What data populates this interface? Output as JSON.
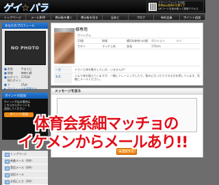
{
  "header": {
    "logo_main": "ゲイ",
    "logo_dot": "☆",
    "logo_end": "パラ",
    "promo_lines": [
      "スマートフォンにも対応",
      "携帯版は登録が必要です",
      "QRコードを読み取って簡単アクセス"
    ]
  },
  "nav": [
    "トップページ",
    "メールBOX",
    "掲示板を書く",
    "掲示板を見る",
    "足あと",
    "プロフ",
    "有料会員",
    "ポイント追加"
  ],
  "sidebar": {
    "profile_title": "あなたのプロフィール",
    "nophoto_text": "NO PHOTO",
    "profile_lines": [
      {
        "label": "名前",
        "value": "やまとに"
      },
      {
        "label": "地域",
        "value": "神奈川県"
      },
      {
        "label": "ログイン",
        "value": "27028"
      },
      {
        "label": "残りポイント",
        "value": "21pt"
      }
    ],
    "profile_link": "プロフィールを変更する",
    "points_title": "ポイントの追加",
    "points_text": [
      "ポイント不足の場合は",
      "こちらからポイントを",
      "追加してください"
    ],
    "points_button": "ポイント追加",
    "menu": [
      "トップページ",
      "新着メール（0件）",
      "受信メール（0件）",
      "送信メール",
      "お気に入り（0件）"
    ]
  },
  "detail": {
    "name_suffix": "様専用",
    "attrs": [
      [
        "ガイシさん",
        "",
        "",
        "",
        ""
      ],
      [
        "33歳",
        "",
        "地域",
        "横浜&神奈川の間",
        "ポジション",
        "リバ"
      ],
      [
        "ガタイ",
        "マッチョ系",
        "",
        "身長",
        "",
        "170cm"
      ]
    ],
    "row1_key": "一言",
    "row1_val": "ドカンと体を動かしたい方、いませんか？",
    "row2_key": "本文",
    "row2_val": "ジムで体を鍛えていますが、一緒にトレーニングしたり、飲みに行ったりできる方を探しています。気軽にメールください。"
  },
  "message": {
    "title": "メッセージを送る",
    "send_label": "送信する"
  },
  "caption": {
    "line1": "体育会系細マッチョの",
    "line2": "イケメンからメールあり!!"
  }
}
